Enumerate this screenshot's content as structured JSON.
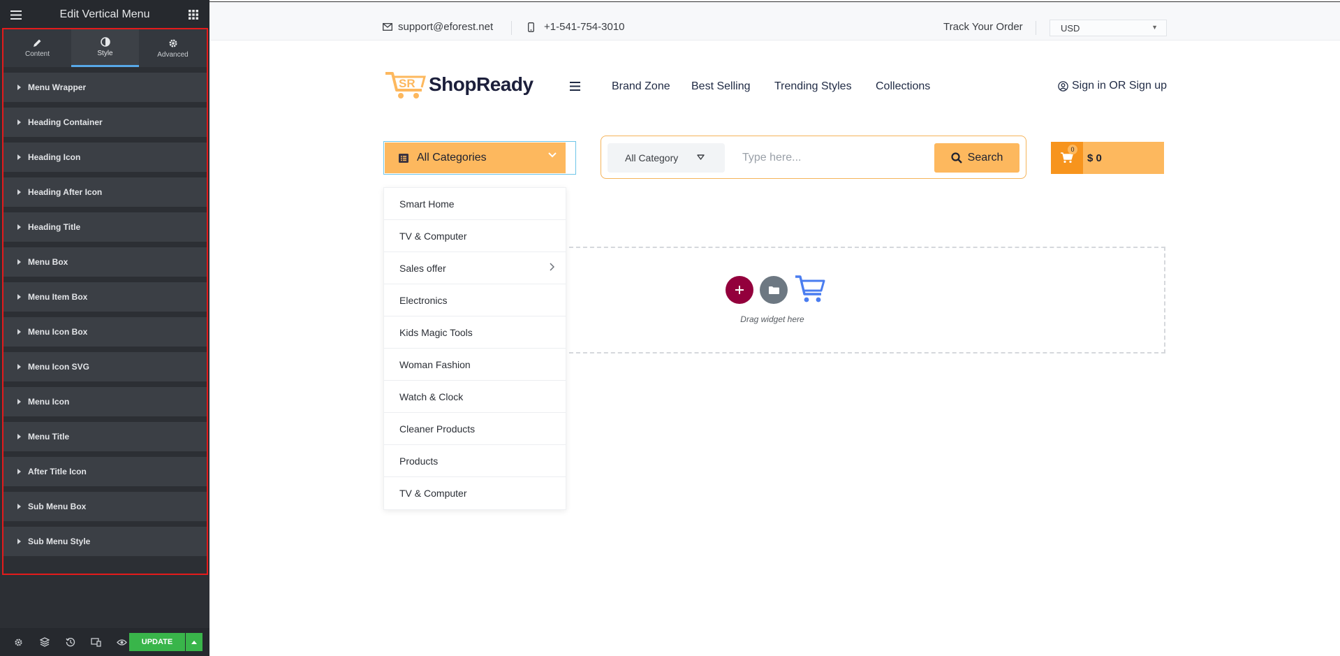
{
  "panel": {
    "title": "Edit Vertical Menu",
    "tabs": [
      {
        "label": "Content",
        "icon": "pencil-icon"
      },
      {
        "label": "Style",
        "icon": "contrast-icon"
      },
      {
        "label": "Advanced",
        "icon": "gear-icon"
      }
    ],
    "active_tab": "Style",
    "sections": [
      "Menu Wrapper",
      "Heading Container",
      "Heading Icon",
      "Heading After Icon",
      "Heading Title",
      "Menu Box",
      "Menu Item Box",
      "Menu Icon Box",
      "Menu Icon SVG",
      "Menu Icon",
      "Menu Title",
      "After Title Icon",
      "Sub Menu Box",
      "Sub Menu Style"
    ],
    "footer": {
      "update_label": "UPDATE",
      "icons": [
        "settings-icon",
        "layers-icon",
        "history-icon",
        "responsive-icon",
        "preview-eye-icon"
      ]
    },
    "highlight_color": "#e41b1b",
    "update_color": "#39b54a"
  },
  "site": {
    "topbar": {
      "email": "support@eforest.net",
      "phone": "+1-541-754-3010",
      "track_order": "Track Your Order",
      "currency": "USD"
    },
    "logo_mark": "SR",
    "logo_text": "ShopReady",
    "nav": [
      "Brand Zone",
      "Best Selling",
      "Trending Styles",
      "Collections"
    ],
    "signin": "Sign in OR Sign up",
    "all_categories": "All Categories",
    "search": {
      "category": "All Category",
      "placeholder": "Type here...",
      "button": "Search"
    },
    "cart": {
      "count": "0",
      "amount": "$ 0"
    },
    "accent_color": "#fdb85e",
    "menu_items": [
      "Smart Home",
      "TV & Computer",
      "Sales offer",
      "Electronics",
      "Kids Magic Tools",
      "Woman Fashion",
      "Watch & Clock",
      "Cleaner Products",
      "Products",
      "TV & Computer"
    ],
    "dropzone_text": "Drag widget here"
  }
}
